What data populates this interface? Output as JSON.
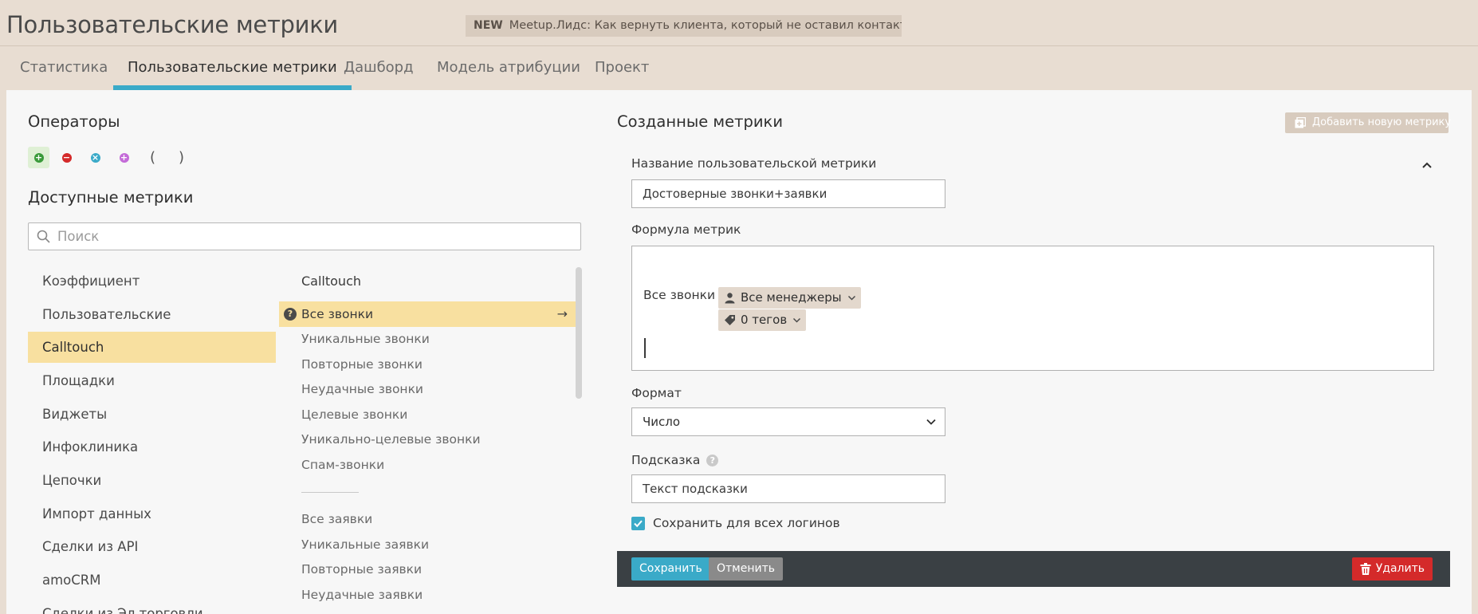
{
  "page": {
    "title": "Пользовательские метрики",
    "news_tag": "NEW",
    "news_text": "Meetup.Лидс: Как вернуть клиента, который не оставил контактов на сайте."
  },
  "tabs": [
    "Статистика",
    "Пользовательские метрики",
    "Дашборд",
    "Модель атрибуции",
    "Проект"
  ],
  "left": {
    "operators_title": "Операторы",
    "operators": [
      {
        "name": "plus",
        "symbol": "+",
        "color": "#3a9a3a"
      },
      {
        "name": "minus",
        "symbol": "−",
        "color": "#d42a2a"
      },
      {
        "name": "multiply",
        "symbol": "×",
        "color": "#3aaac8"
      },
      {
        "name": "divide",
        "symbol": "÷",
        "color": "#c46ad8"
      },
      {
        "name": "open-paren",
        "symbol": "("
      },
      {
        "name": "close-paren",
        "symbol": ")"
      }
    ],
    "available_title": "Доступные метрики",
    "search_placeholder": "Поиск",
    "categories": [
      "Коэффициент",
      "Пользовательские",
      "Calltouch",
      "Площадки",
      "Виджеты",
      "Инфоклиника",
      "Цепочки",
      "Импорт данных",
      "Сделки из API",
      "amoCRM",
      "Сделки из Эл.торговли"
    ],
    "active_category": "Calltouch",
    "metrics_header": "Calltouch",
    "metrics_group1": [
      "Все звонки",
      "Уникальные звонки",
      "Повторные звонки",
      "Неудачные звонки",
      "Целевые звонки",
      "Уникально-целевые звонки",
      "Спам-звонки"
    ],
    "metrics_group2": [
      "Все заявки",
      "Уникальные заявки",
      "Повторные заявки",
      "Неудачные заявки"
    ],
    "active_metric": "Все звонки"
  },
  "right": {
    "title": "Созданные метрики",
    "add_button": "Добавить новую метрику",
    "name_label": "Название пользовательской метрики",
    "name_value": "Достоверные звонки+заявки",
    "formula_label": "Формула метрик",
    "formula_text": "Все звонки",
    "chip_managers": "Все менеджеры",
    "chip_tags": "0 тегов",
    "format_label": "Формат",
    "format_value": "Число",
    "hint_label": "Подсказка",
    "hint_value": "Текст подсказки",
    "save_all_label": "Сохранить для всех логинов",
    "save_all_checked": true,
    "save_button": "Сохранить",
    "cancel_button": "Отменить",
    "delete_button": "Удалить"
  }
}
